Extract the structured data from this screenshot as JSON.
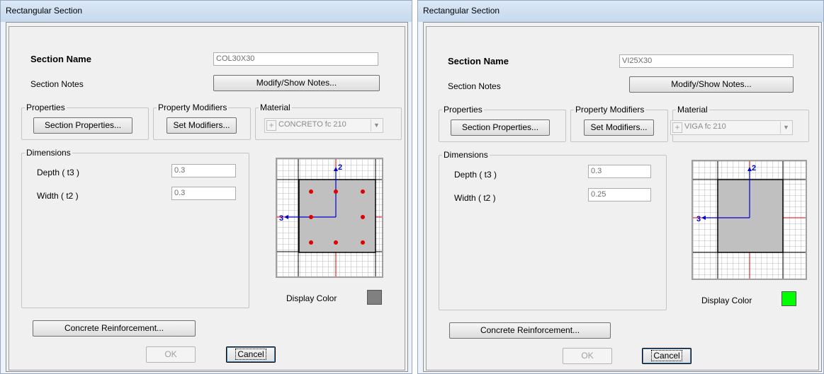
{
  "windows": [
    {
      "title": "Rectangular Section",
      "section_name_label": "Section Name",
      "section_name_value": "COL30X30",
      "section_notes_label": "Section Notes",
      "modify_notes_button": "Modify/Show Notes...",
      "properties_group": "Properties",
      "section_properties_button": "Section Properties...",
      "modifiers_group": "Property Modifiers",
      "set_modifiers_button": "Set Modifiers...",
      "material_group": "Material",
      "material_plus": "+",
      "material_value": "CONCRETO fc 210",
      "dimensions_group": "Dimensions",
      "depth_label": "Depth  ( t3 )",
      "depth_value": "0.3",
      "width_label": "Width  ( t2 )",
      "width_value": "0.3",
      "axis_2_label": "2",
      "axis_3_label": "3",
      "display_color_label": "Display Color",
      "display_color": "#808080",
      "show_rebars": true,
      "concrete_reinforcement_button": "Concrete Reinforcement...",
      "ok_button": "OK",
      "cancel_button": "Cancel"
    },
    {
      "title": "Rectangular Section",
      "section_name_label": "Section Name",
      "section_name_value": "VI25X30",
      "section_notes_label": "Section Notes",
      "modify_notes_button": "Modify/Show Notes...",
      "properties_group": "Properties",
      "section_properties_button": "Section Properties...",
      "modifiers_group": "Property Modifiers",
      "set_modifiers_button": "Set Modifiers...",
      "material_group": "Material",
      "material_plus": "+",
      "material_value": "VIGA fc 210",
      "dimensions_group": "Dimensions",
      "depth_label": "Depth  ( t3 )",
      "depth_value": "0.3",
      "width_label": "Width  ( t2 )",
      "width_value": "0.25",
      "axis_2_label": "2",
      "axis_3_label": "3",
      "display_color_label": "Display Color",
      "display_color": "#00ff00",
      "show_rebars": false,
      "concrete_reinforcement_button": "Concrete Reinforcement...",
      "ok_button": "OK",
      "cancel_button": "Cancel"
    }
  ]
}
